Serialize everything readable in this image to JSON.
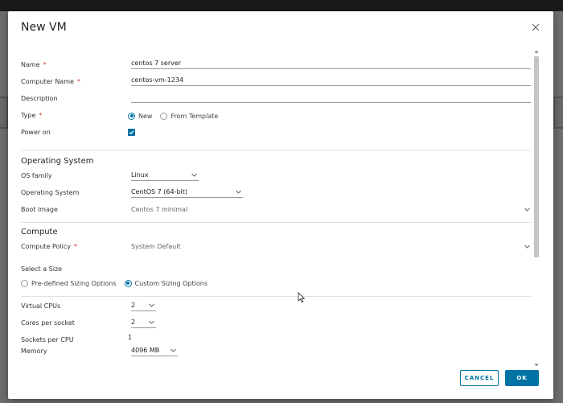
{
  "dialog": {
    "title": "New VM"
  },
  "general": {
    "name_label": "Name",
    "name_value": "centos 7 server",
    "computer_name_label": "Computer Name",
    "computer_name_value": "centos-vm-1234",
    "description_label": "Description",
    "description_value": "",
    "type_label": "Type",
    "type_options": [
      "New",
      "From Template"
    ],
    "type_selected": "New",
    "power_on_label": "Power on",
    "power_on_checked": true,
    "required_mark": "*"
  },
  "os": {
    "section_title": "Operating System",
    "family_label": "OS family",
    "family_value": "Linux",
    "os_label": "Operating System",
    "os_value": "CentOS 7 (64-bit)",
    "boot_label": "Boot image",
    "boot_value": "Centos 7 minimal"
  },
  "compute": {
    "section_title": "Compute",
    "policy_label": "Compute Policy",
    "policy_value": "System Default",
    "size_label": "Select a Size",
    "size_options": [
      "Pre-defined Sizing Options",
      "Custom Sizing Options"
    ],
    "size_selected": "Custom Sizing Options",
    "vcpu_label": "Virtual CPUs",
    "vcpu_value": "2",
    "cores_label": "Cores per socket",
    "cores_value": "2",
    "sockets_label": "Sockets per CPU",
    "sockets_value": "1",
    "memory_label": "Memory",
    "memory_value": "4096 MB"
  },
  "footer": {
    "cancel_label": "CANCEL",
    "ok_label": "OK"
  },
  "colors": {
    "accent": "#0072a3",
    "required": "#d9342b"
  }
}
